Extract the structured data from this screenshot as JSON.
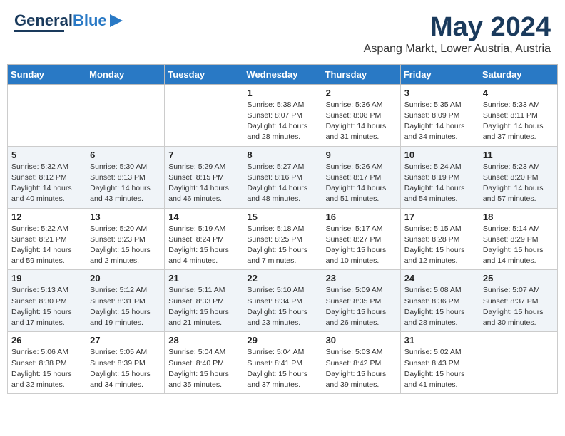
{
  "header": {
    "logo_general": "General",
    "logo_blue": "Blue",
    "title": "May 2024",
    "location": "Aspang Markt, Lower Austria, Austria"
  },
  "weekdays": [
    "Sunday",
    "Monday",
    "Tuesday",
    "Wednesday",
    "Thursday",
    "Friday",
    "Saturday"
  ],
  "weeks": [
    [
      {
        "day": "",
        "sunrise": "",
        "sunset": "",
        "daylight": ""
      },
      {
        "day": "",
        "sunrise": "",
        "sunset": "",
        "daylight": ""
      },
      {
        "day": "",
        "sunrise": "",
        "sunset": "",
        "daylight": ""
      },
      {
        "day": "1",
        "sunrise": "Sunrise: 5:38 AM",
        "sunset": "Sunset: 8:07 PM",
        "daylight": "Daylight: 14 hours and 28 minutes."
      },
      {
        "day": "2",
        "sunrise": "Sunrise: 5:36 AM",
        "sunset": "Sunset: 8:08 PM",
        "daylight": "Daylight: 14 hours and 31 minutes."
      },
      {
        "day": "3",
        "sunrise": "Sunrise: 5:35 AM",
        "sunset": "Sunset: 8:09 PM",
        "daylight": "Daylight: 14 hours and 34 minutes."
      },
      {
        "day": "4",
        "sunrise": "Sunrise: 5:33 AM",
        "sunset": "Sunset: 8:11 PM",
        "daylight": "Daylight: 14 hours and 37 minutes."
      }
    ],
    [
      {
        "day": "5",
        "sunrise": "Sunrise: 5:32 AM",
        "sunset": "Sunset: 8:12 PM",
        "daylight": "Daylight: 14 hours and 40 minutes."
      },
      {
        "day": "6",
        "sunrise": "Sunrise: 5:30 AM",
        "sunset": "Sunset: 8:13 PM",
        "daylight": "Daylight: 14 hours and 43 minutes."
      },
      {
        "day": "7",
        "sunrise": "Sunrise: 5:29 AM",
        "sunset": "Sunset: 8:15 PM",
        "daylight": "Daylight: 14 hours and 46 minutes."
      },
      {
        "day": "8",
        "sunrise": "Sunrise: 5:27 AM",
        "sunset": "Sunset: 8:16 PM",
        "daylight": "Daylight: 14 hours and 48 minutes."
      },
      {
        "day": "9",
        "sunrise": "Sunrise: 5:26 AM",
        "sunset": "Sunset: 8:17 PM",
        "daylight": "Daylight: 14 hours and 51 minutes."
      },
      {
        "day": "10",
        "sunrise": "Sunrise: 5:24 AM",
        "sunset": "Sunset: 8:19 PM",
        "daylight": "Daylight: 14 hours and 54 minutes."
      },
      {
        "day": "11",
        "sunrise": "Sunrise: 5:23 AM",
        "sunset": "Sunset: 8:20 PM",
        "daylight": "Daylight: 14 hours and 57 minutes."
      }
    ],
    [
      {
        "day": "12",
        "sunrise": "Sunrise: 5:22 AM",
        "sunset": "Sunset: 8:21 PM",
        "daylight": "Daylight: 14 hours and 59 minutes."
      },
      {
        "day": "13",
        "sunrise": "Sunrise: 5:20 AM",
        "sunset": "Sunset: 8:23 PM",
        "daylight": "Daylight: 15 hours and 2 minutes."
      },
      {
        "day": "14",
        "sunrise": "Sunrise: 5:19 AM",
        "sunset": "Sunset: 8:24 PM",
        "daylight": "Daylight: 15 hours and 4 minutes."
      },
      {
        "day": "15",
        "sunrise": "Sunrise: 5:18 AM",
        "sunset": "Sunset: 8:25 PM",
        "daylight": "Daylight: 15 hours and 7 minutes."
      },
      {
        "day": "16",
        "sunrise": "Sunrise: 5:17 AM",
        "sunset": "Sunset: 8:27 PM",
        "daylight": "Daylight: 15 hours and 10 minutes."
      },
      {
        "day": "17",
        "sunrise": "Sunrise: 5:15 AM",
        "sunset": "Sunset: 8:28 PM",
        "daylight": "Daylight: 15 hours and 12 minutes."
      },
      {
        "day": "18",
        "sunrise": "Sunrise: 5:14 AM",
        "sunset": "Sunset: 8:29 PM",
        "daylight": "Daylight: 15 hours and 14 minutes."
      }
    ],
    [
      {
        "day": "19",
        "sunrise": "Sunrise: 5:13 AM",
        "sunset": "Sunset: 8:30 PM",
        "daylight": "Daylight: 15 hours and 17 minutes."
      },
      {
        "day": "20",
        "sunrise": "Sunrise: 5:12 AM",
        "sunset": "Sunset: 8:31 PM",
        "daylight": "Daylight: 15 hours and 19 minutes."
      },
      {
        "day": "21",
        "sunrise": "Sunrise: 5:11 AM",
        "sunset": "Sunset: 8:33 PM",
        "daylight": "Daylight: 15 hours and 21 minutes."
      },
      {
        "day": "22",
        "sunrise": "Sunrise: 5:10 AM",
        "sunset": "Sunset: 8:34 PM",
        "daylight": "Daylight: 15 hours and 23 minutes."
      },
      {
        "day": "23",
        "sunrise": "Sunrise: 5:09 AM",
        "sunset": "Sunset: 8:35 PM",
        "daylight": "Daylight: 15 hours and 26 minutes."
      },
      {
        "day": "24",
        "sunrise": "Sunrise: 5:08 AM",
        "sunset": "Sunset: 8:36 PM",
        "daylight": "Daylight: 15 hours and 28 minutes."
      },
      {
        "day": "25",
        "sunrise": "Sunrise: 5:07 AM",
        "sunset": "Sunset: 8:37 PM",
        "daylight": "Daylight: 15 hours and 30 minutes."
      }
    ],
    [
      {
        "day": "26",
        "sunrise": "Sunrise: 5:06 AM",
        "sunset": "Sunset: 8:38 PM",
        "daylight": "Daylight: 15 hours and 32 minutes."
      },
      {
        "day": "27",
        "sunrise": "Sunrise: 5:05 AM",
        "sunset": "Sunset: 8:39 PM",
        "daylight": "Daylight: 15 hours and 34 minutes."
      },
      {
        "day": "28",
        "sunrise": "Sunrise: 5:04 AM",
        "sunset": "Sunset: 8:40 PM",
        "daylight": "Daylight: 15 hours and 35 minutes."
      },
      {
        "day": "29",
        "sunrise": "Sunrise: 5:04 AM",
        "sunset": "Sunset: 8:41 PM",
        "daylight": "Daylight: 15 hours and 37 minutes."
      },
      {
        "day": "30",
        "sunrise": "Sunrise: 5:03 AM",
        "sunset": "Sunset: 8:42 PM",
        "daylight": "Daylight: 15 hours and 39 minutes."
      },
      {
        "day": "31",
        "sunrise": "Sunrise: 5:02 AM",
        "sunset": "Sunset: 8:43 PM",
        "daylight": "Daylight: 15 hours and 41 minutes."
      },
      {
        "day": "",
        "sunrise": "",
        "sunset": "",
        "daylight": ""
      }
    ]
  ]
}
